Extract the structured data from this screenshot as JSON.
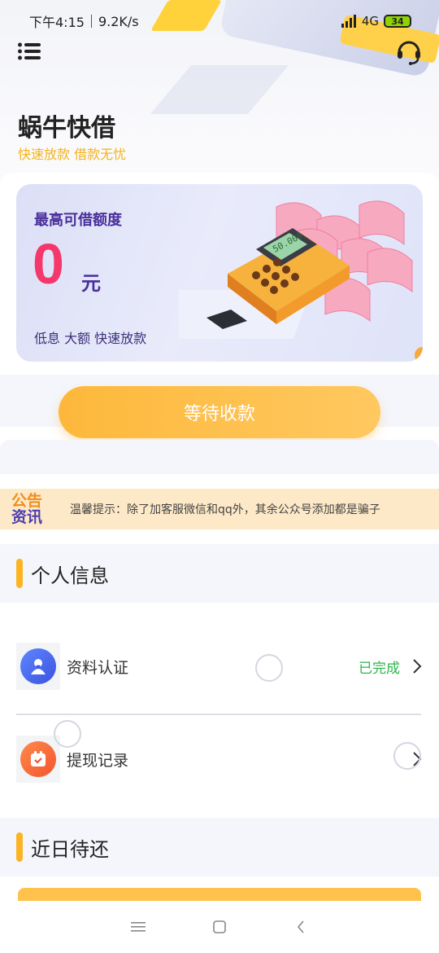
{
  "status_bar": {
    "time": "下午4:15",
    "speed": "9.2K/s",
    "network": "4G",
    "battery": "34"
  },
  "header": {
    "title": "蜗牛快借",
    "subtitle": "快速放款 借款无忧",
    "menu_icon": "menu-icon",
    "service_icon": "headset-icon"
  },
  "credit_card": {
    "label": "最高可借额度",
    "amount": "0",
    "unit": "元",
    "desc": "低息 大额 快速放款",
    "illustration_text": "50.000"
  },
  "action_button": {
    "label": "等待收款"
  },
  "notice": {
    "badge_line1": "公告",
    "badge_line2": "资讯",
    "text": "温馨提示：除了加客服微信和qq外，其余公众号添加都是骗子"
  },
  "personal_info": {
    "title": "个人信息",
    "items": [
      {
        "label": "资料认证",
        "status": "已完成",
        "icon": "user-verify-icon"
      },
      {
        "label": "提现记录",
        "status": "",
        "icon": "calendar-icon"
      }
    ]
  },
  "recent_repay": {
    "title": "近日待还"
  },
  "colors": {
    "accent": "#fdb423",
    "amount": "#f5386b",
    "success": "#2bb54a",
    "purple": "#4a2f9a"
  }
}
